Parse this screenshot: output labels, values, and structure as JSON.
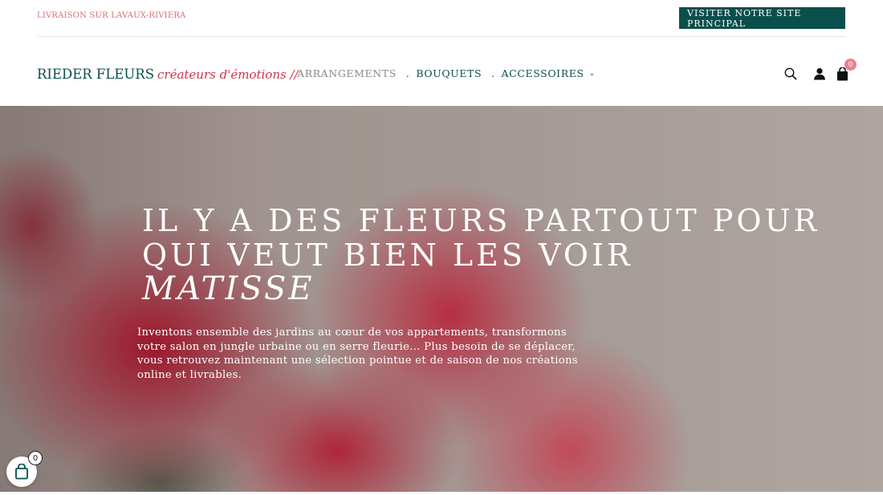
{
  "topbar": {
    "notice": "LIVRAISON SUR LAVAUX-RIVIERA",
    "visit_button": "VISITER NOTRE SITE PRINCIPAL"
  },
  "header": {
    "logo_name": "RIEDER FLEURS",
    "logo_tagline": "créateurs d'émotions //",
    "nav": [
      {
        "label": "ARRANGEMENTS"
      },
      {
        "label": "BOUQUETS"
      },
      {
        "label": "ACCESSOIRES"
      }
    ],
    "icons": [
      "search-icon",
      "user-icon",
      "shopping-bag-icon"
    ],
    "cart_count": "0"
  },
  "hero": {
    "title": "IL Y A DES FLEURS PARTOUT POUR QUI VEUT BIEN LES VOIR",
    "quote_author": "MATISSE",
    "text": "Inventons ensemble des jardins au cœur de vos appartements, transformons votre salon en jungle urbaine ou en serre fleurie… Plus besoin de se déplacer, vous retrouvez maintenant une sélection pointue et de saison de nos créations online et livrables."
  },
  "floating_cart": {
    "count": "0"
  },
  "colors": {
    "brand": "#0b4f4c",
    "accent": "#c9354a",
    "notice": "#e06d74"
  }
}
